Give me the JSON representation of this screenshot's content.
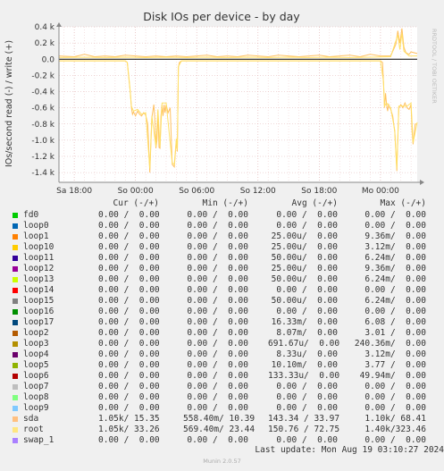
{
  "chart_data": {
    "type": "line",
    "title": "Disk IOs per device - by day",
    "ylabel": "IOs/second read (-) / write (+)",
    "watermark": "RRDTOOL / TOBI OETIKER",
    "y_ticks": [
      "0.4 k",
      "0.2 k",
      "0.0",
      "-0.2 k",
      "-0.4 k",
      "-0.6 k",
      "-0.8 k",
      "-1.0 k",
      "-1.2 k",
      "-1.4 k"
    ],
    "y_tick_values": [
      400,
      200,
      0,
      -200,
      -400,
      -600,
      -800,
      -1000,
      -1200,
      -1400
    ],
    "ylim": [
      -1520,
      400
    ],
    "x_ticks": [
      "Sa 18:00",
      "So 00:00",
      "So 06:00",
      "So 12:00",
      "So 18:00",
      "Mo 00:00"
    ],
    "x_tick_hours": [
      0,
      6,
      12,
      18,
      24,
      30
    ],
    "xlim_hours": [
      -1.5,
      33.6
    ],
    "series": [
      {
        "name": "sda",
        "color": "#ffc060",
        "note": "read (-) as negative, write (+) as positive; hours relative to Sa 18:00",
        "read": [
          [
            -1.5,
            -20
          ],
          [
            5.0,
            -20
          ],
          [
            5.2,
            -40
          ],
          [
            5.4,
            -300
          ],
          [
            5.5,
            -420
          ],
          [
            5.6,
            -600
          ],
          [
            5.7,
            -680
          ],
          [
            5.8,
            -650
          ],
          [
            6.0,
            -700
          ],
          [
            6.2,
            -640
          ],
          [
            6.4,
            -680
          ],
          [
            6.6,
            -700
          ],
          [
            6.8,
            -660
          ],
          [
            7.0,
            -690
          ],
          [
            7.2,
            -800
          ],
          [
            7.4,
            -1400
          ],
          [
            7.6,
            -720
          ],
          [
            7.8,
            -560
          ],
          [
            7.9,
            -760
          ],
          [
            8.0,
            -1100
          ],
          [
            8.1,
            -1000
          ],
          [
            8.2,
            -640
          ],
          [
            8.3,
            -1090
          ],
          [
            8.4,
            -1100
          ],
          [
            8.5,
            -700
          ],
          [
            8.6,
            -560
          ],
          [
            8.7,
            -700
          ],
          [
            8.8,
            -560
          ],
          [
            8.9,
            -660
          ],
          [
            9.0,
            -560
          ],
          [
            9.2,
            -660
          ],
          [
            9.4,
            -600
          ],
          [
            9.6,
            -1300
          ],
          [
            9.8,
            -1330
          ],
          [
            10.0,
            -1000
          ],
          [
            10.1,
            -1140
          ],
          [
            10.2,
            -100
          ],
          [
            10.3,
            -40
          ],
          [
            10.5,
            -20
          ],
          [
            30.0,
            -20
          ],
          [
            30.2,
            -40
          ],
          [
            30.3,
            -300
          ],
          [
            30.4,
            -600
          ],
          [
            30.5,
            -420
          ],
          [
            30.6,
            -560
          ],
          [
            30.7,
            -640
          ],
          [
            30.8,
            -560
          ],
          [
            31.0,
            -620
          ],
          [
            31.2,
            -700
          ],
          [
            31.4,
            -900
          ],
          [
            31.6,
            -1380
          ],
          [
            31.8,
            -600
          ],
          [
            32.0,
            -560
          ],
          [
            32.2,
            -600
          ],
          [
            32.4,
            -540
          ],
          [
            32.6,
            -600
          ],
          [
            32.8,
            -620
          ],
          [
            33.0,
            -560
          ],
          [
            33.1,
            -900
          ],
          [
            33.2,
            -1050
          ],
          [
            33.4,
            -800
          ],
          [
            33.6,
            -800
          ]
        ],
        "write": [
          [
            -1.5,
            40
          ],
          [
            0.0,
            30
          ],
          [
            1.0,
            60
          ],
          [
            2.0,
            30
          ],
          [
            3.0,
            40
          ],
          [
            4.0,
            30
          ],
          [
            5.0,
            50
          ],
          [
            6.0,
            40
          ],
          [
            7.0,
            30
          ],
          [
            8.0,
            40
          ],
          [
            9.0,
            30
          ],
          [
            10.0,
            40
          ],
          [
            11.0,
            30
          ],
          [
            12.0,
            40
          ],
          [
            13.0,
            50
          ],
          [
            14.0,
            30
          ],
          [
            15.0,
            40
          ],
          [
            16.0,
            30
          ],
          [
            17.0,
            50
          ],
          [
            18.0,
            40
          ],
          [
            19.0,
            30
          ],
          [
            20.0,
            50
          ],
          [
            21.0,
            40
          ],
          [
            22.0,
            30
          ],
          [
            23.0,
            40
          ],
          [
            24.0,
            50
          ],
          [
            25.0,
            30
          ],
          [
            26.0,
            40
          ],
          [
            27.0,
            50
          ],
          [
            28.0,
            30
          ],
          [
            29.0,
            60
          ],
          [
            30.0,
            40
          ],
          [
            31.0,
            40
          ],
          [
            31.5,
            180
          ],
          [
            31.7,
            350
          ],
          [
            31.9,
            200
          ],
          [
            32.1,
            380
          ],
          [
            32.3,
            150
          ],
          [
            32.5,
            80
          ],
          [
            32.8,
            60
          ],
          [
            33.0,
            90
          ],
          [
            33.6,
            70
          ]
        ]
      },
      {
        "name": "root",
        "color": "#ffe066",
        "read": [
          [
            -1.5,
            -20
          ],
          [
            5.0,
            -20
          ],
          [
            5.2,
            -40
          ],
          [
            5.4,
            -280
          ],
          [
            5.6,
            -580
          ],
          [
            5.8,
            -640
          ],
          [
            6.2,
            -620
          ],
          [
            6.6,
            -680
          ],
          [
            7.0,
            -660
          ],
          [
            7.4,
            -1350
          ],
          [
            7.6,
            -700
          ],
          [
            8.0,
            -1080
          ],
          [
            8.2,
            -620
          ],
          [
            8.4,
            -1080
          ],
          [
            8.6,
            -540
          ],
          [
            9.0,
            -540
          ],
          [
            9.6,
            -1280
          ],
          [
            9.8,
            -1300
          ],
          [
            10.0,
            -980
          ],
          [
            10.1,
            -1120
          ],
          [
            10.2,
            -90
          ],
          [
            10.5,
            -20
          ],
          [
            30.0,
            -20
          ],
          [
            30.3,
            -280
          ],
          [
            30.4,
            -580
          ],
          [
            30.6,
            -540
          ],
          [
            31.0,
            -600
          ],
          [
            31.4,
            -880
          ],
          [
            31.6,
            -1350
          ],
          [
            31.8,
            -580
          ],
          [
            32.2,
            -580
          ],
          [
            32.6,
            -580
          ],
          [
            33.0,
            -540
          ],
          [
            33.2,
            -1030
          ],
          [
            33.6,
            -780
          ]
        ],
        "write": [
          [
            -1.5,
            20
          ],
          [
            1.0,
            25
          ],
          [
            3.0,
            20
          ],
          [
            5.0,
            25
          ],
          [
            7.0,
            20
          ],
          [
            9.0,
            25
          ],
          [
            11.0,
            20
          ],
          [
            13.0,
            25
          ],
          [
            15.0,
            20
          ],
          [
            17.0,
            25
          ],
          [
            19.0,
            20
          ],
          [
            21.0,
            25
          ],
          [
            23.0,
            20
          ],
          [
            25.0,
            25
          ],
          [
            27.0,
            20
          ],
          [
            29.0,
            25
          ],
          [
            31.0,
            30
          ],
          [
            31.7,
            300
          ],
          [
            31.9,
            120
          ],
          [
            32.1,
            320
          ],
          [
            32.3,
            100
          ],
          [
            32.8,
            40
          ],
          [
            33.6,
            40
          ]
        ]
      }
    ]
  },
  "legend": {
    "headers": {
      "cur": "Cur (-/+)",
      "min": "Min (-/+)",
      "avg": "Avg (-/+)",
      "max": "Max (-/+)"
    },
    "rows": [
      {
        "name": "fd0",
        "color": "#00cc00",
        "cur": "0.00 /  0.00",
        "min": "0.00 /  0.00",
        "avg": "0.00 /  0.00",
        "max": "0.00 /  0.00"
      },
      {
        "name": "loop0",
        "color": "#0066b3",
        "cur": "0.00 /  0.00",
        "min": "0.00 /  0.00",
        "avg": "0.00 /  0.00",
        "max": "0.00 /  0.00"
      },
      {
        "name": "loop1",
        "color": "#ff8000",
        "cur": "0.00 /  0.00",
        "min": "0.00 /  0.00",
        "avg": "25.00u/  0.00",
        "max": "9.36m/  0.00"
      },
      {
        "name": "loop10",
        "color": "#ffcc00",
        "cur": "0.00 /  0.00",
        "min": "0.00 /  0.00",
        "avg": "25.00u/  0.00",
        "max": "3.12m/  0.00"
      },
      {
        "name": "loop11",
        "color": "#330099",
        "cur": "0.00 /  0.00",
        "min": "0.00 /  0.00",
        "avg": "50.00u/  0.00",
        "max": "6.24m/  0.00"
      },
      {
        "name": "loop12",
        "color": "#990099",
        "cur": "0.00 /  0.00",
        "min": "0.00 /  0.00",
        "avg": "25.00u/  0.00",
        "max": "9.36m/  0.00"
      },
      {
        "name": "loop13",
        "color": "#ccff00",
        "cur": "0.00 /  0.00",
        "min": "0.00 /  0.00",
        "avg": "50.00u/  0.00",
        "max": "6.24m/  0.00"
      },
      {
        "name": "loop14",
        "color": "#ff0000",
        "cur": "0.00 /  0.00",
        "min": "0.00 /  0.00",
        "avg": "0.00 /  0.00",
        "max": "0.00 /  0.00"
      },
      {
        "name": "loop15",
        "color": "#808080",
        "cur": "0.00 /  0.00",
        "min": "0.00 /  0.00",
        "avg": "50.00u/  0.00",
        "max": "6.24m/  0.00"
      },
      {
        "name": "loop16",
        "color": "#008f00",
        "cur": "0.00 /  0.00",
        "min": "0.00 /  0.00",
        "avg": "0.00 /  0.00",
        "max": "0.00 /  0.00"
      },
      {
        "name": "loop17",
        "color": "#00487d",
        "cur": "0.00 /  0.00",
        "min": "0.00 /  0.00",
        "avg": "16.33m/  0.00",
        "max": "6.08 /  0.00"
      },
      {
        "name": "loop2",
        "color": "#b35a00",
        "cur": "0.00 /  0.00",
        "min": "0.00 /  0.00",
        "avg": "8.07m/  0.00",
        "max": "3.01 /  0.00"
      },
      {
        "name": "loop3",
        "color": "#b38f00",
        "cur": "0.00 /  0.00",
        "min": "0.00 /  0.00",
        "avg": "691.67u/  0.00",
        "max": "240.36m/  0.00"
      },
      {
        "name": "loop4",
        "color": "#6b006b",
        "cur": "0.00 /  0.00",
        "min": "0.00 /  0.00",
        "avg": "8.33u/  0.00",
        "max": "3.12m/  0.00"
      },
      {
        "name": "loop5",
        "color": "#8fb300",
        "cur": "0.00 /  0.00",
        "min": "0.00 /  0.00",
        "avg": "10.10m/  0.00",
        "max": "3.77 /  0.00"
      },
      {
        "name": "loop6",
        "color": "#b30000",
        "cur": "0.00 /  0.00",
        "min": "0.00 /  0.00",
        "avg": "133.33u/  0.00",
        "max": "49.94m/  0.00"
      },
      {
        "name": "loop7",
        "color": "#bebebe",
        "cur": "0.00 /  0.00",
        "min": "0.00 /  0.00",
        "avg": "0.00 /  0.00",
        "max": "0.00 /  0.00"
      },
      {
        "name": "loop8",
        "color": "#80ff80",
        "cur": "0.00 /  0.00",
        "min": "0.00 /  0.00",
        "avg": "0.00 /  0.00",
        "max": "0.00 /  0.00"
      },
      {
        "name": "loop9",
        "color": "#80c9ff",
        "cur": "0.00 /  0.00",
        "min": "0.00 /  0.00",
        "avg": "0.00 /  0.00",
        "max": "0.00 /  0.00"
      },
      {
        "name": "sda",
        "color": "#ffc080",
        "cur": "1.05k/ 15.35",
        "min": "558.40m/ 10.39",
        "avg": "143.34 / 33.97",
        "max": "1.10k/ 68.41"
      },
      {
        "name": "root",
        "color": "#ffe680",
        "cur": "1.05k/ 33.26",
        "min": "569.40m/ 23.44",
        "avg": "150.76 / 72.75",
        "max": "1.40k/323.46"
      },
      {
        "name": "swap_1",
        "color": "#aa80ff",
        "cur": "0.00 /  0.00",
        "min": "0.00 /  0.00",
        "avg": "0.00 /  0.00",
        "max": "0.00 /  0.00"
      }
    ]
  },
  "footer": {
    "last_update": "Last update: Mon Aug 19 03:10:27 2024",
    "version": "Munin 2.0.57"
  }
}
